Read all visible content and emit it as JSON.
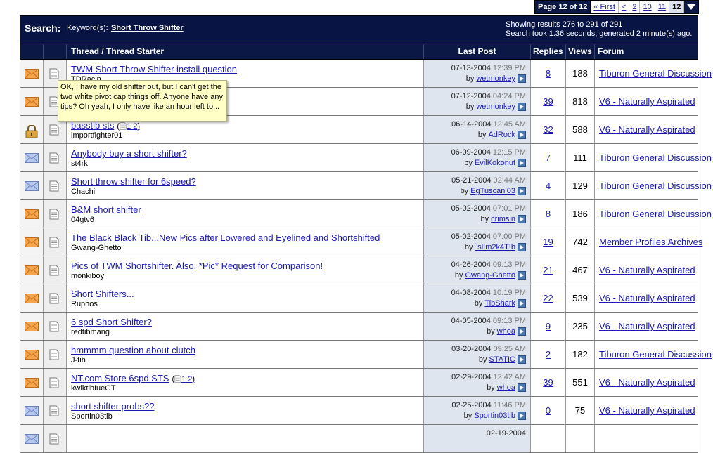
{
  "pagination": {
    "label": "Page 12 of 12",
    "first": "« First",
    "prev": "<",
    "pages": [
      "2",
      "10",
      "11"
    ],
    "current": "12",
    "menu_icon": "triangle-down-icon"
  },
  "search_header": {
    "label": "Search:",
    "keyword_label": "Keyword(s):",
    "keyword": "Short Throw Shifter",
    "results_text": "Showing results 276 to 291 of 291",
    "timing_text": "Search took 1.36 seconds; generated 2 minute(s) ago."
  },
  "columns": {
    "thread": "Thread / Thread Starter",
    "last_post": "Last Post",
    "replies": "Replies",
    "views": "Views",
    "forum": "Forum"
  },
  "tooltip": {
    "text": "OK, I have my old shifter out, but I can't get the two white pivot cap things off.  Anyone have any tips?  Oh yeah, I only have like an hour left to..."
  },
  "rows": [
    {
      "icon": "envelope-orange-icon",
      "title": "TWM Short Throw Shifter install question",
      "starter": "TDRacin",
      "pages": "",
      "date": "07-13-2004",
      "time": "12:39 PM",
      "by_label": "by",
      "by": "wetmonkey",
      "replies": "8",
      "views": "188",
      "forum": "Tiburon General Discussion"
    },
    {
      "icon": "envelope-orange-icon",
      "title": "",
      "starter": "",
      "pages": "",
      "date": "07-12-2004",
      "time": "04:24 PM",
      "by_label": "by",
      "by": "wetmonkey",
      "replies": "39",
      "views": "818",
      "forum": "V6 - Naturally Aspirated"
    },
    {
      "icon": "lock-icon",
      "title": "basstib sts",
      "starter": "importfighter01",
      "pages": "1 2",
      "date": "06-14-2004",
      "time": "12:45 AM",
      "by_label": "by",
      "by": "AdRock",
      "replies": "32",
      "views": "588",
      "forum": "V6 - Naturally Aspirated"
    },
    {
      "icon": "envelope-blue-icon",
      "title": "Anybody buy a short shifter?",
      "starter": "st4rk",
      "pages": "",
      "date": "06-09-2004",
      "time": "12:15 PM",
      "by_label": "by",
      "by": "EvilKokonut",
      "replies": "7",
      "views": "111",
      "forum": "Tiburon General Discussion"
    },
    {
      "icon": "envelope-blue-icon",
      "title": "Short throw shifter for 6speed?",
      "starter": "Chachi",
      "pages": "",
      "date": "05-21-2004",
      "time": "02:44 AM",
      "by_label": "by",
      "by": "EgTuscani03",
      "replies": "4",
      "views": "129",
      "forum": "Tiburon General Discussion"
    },
    {
      "icon": "envelope-orange-icon",
      "title": "B&M short shifter",
      "starter": "04gtv6",
      "pages": "",
      "date": "05-02-2004",
      "time": "07:01 PM",
      "by_label": "by",
      "by": "crimsin",
      "replies": "8",
      "views": "186",
      "forum": "Tiburon General Discussion"
    },
    {
      "icon": "envelope-orange-icon",
      "title": "The Black Black Tib...New Pics after Lowered and Eyelined and Shortshifted",
      "starter": "Gwang-Ghetto",
      "pages": "",
      "date": "05-02-2004",
      "time": "07:00 PM",
      "by_label": "by",
      "by": "`sl!m2k4T!b",
      "replies": "19",
      "views": "742",
      "forum": "Member Profiles Archives"
    },
    {
      "icon": "envelope-orange-icon",
      "title": "Pics of TWM Shortshifter. Also, *Pic* Request for Comparison!",
      "starter": "monkiboy",
      "pages": "",
      "date": "04-26-2004",
      "time": "09:13 PM",
      "by_label": "by",
      "by": "Gwang-Ghetto",
      "replies": "21",
      "views": "467",
      "forum": "V6 - Naturally Aspirated"
    },
    {
      "icon": "envelope-orange-icon",
      "title": "Short Shifters...",
      "starter": "Ruphos",
      "pages": "",
      "date": "04-08-2004",
      "time": "10:19 PM",
      "by_label": "by",
      "by": "TibShark",
      "replies": "22",
      "views": "539",
      "forum": "V6 - Naturally Aspirated"
    },
    {
      "icon": "envelope-orange-icon",
      "title": "6 spd Short Shifter?",
      "starter": "redtibmang",
      "pages": "",
      "date": "04-05-2004",
      "time": "09:13 PM",
      "by_label": "by",
      "by": "whoa",
      "replies": "9",
      "views": "235",
      "forum": "V6 - Naturally Aspirated"
    },
    {
      "icon": "envelope-orange-icon",
      "title": "hmmmm question about clutch",
      "starter": "J-tib",
      "pages": "",
      "date": "03-20-2004",
      "time": "09:25 AM",
      "by_label": "by",
      "by": "STATIC",
      "replies": "2",
      "views": "182",
      "forum": "Tiburon General Discussion"
    },
    {
      "icon": "envelope-orange-icon",
      "title": "NT.com Store 6spd STS",
      "starter": "kwiktibIueGT",
      "pages": "1 2",
      "date": "02-29-2004",
      "time": "12:42 AM",
      "by_label": "by",
      "by": "whoa",
      "replies": "39",
      "views": "551",
      "forum": "V6 - Naturally Aspirated"
    },
    {
      "icon": "envelope-blue-icon",
      "title": "short shifter probs??",
      "starter": "Sportin03tib",
      "pages": "",
      "date": "02-25-2004",
      "time": "11:46 PM",
      "by_label": "by",
      "by": "Sportin03tib",
      "replies": "0",
      "views": "75",
      "forum": "V6 - Naturally Aspirated"
    },
    {
      "icon": "envelope-blue-icon",
      "title": "",
      "starter": "",
      "pages": "",
      "date": "02-19-2004",
      "time": "",
      "by_label": "",
      "by": "",
      "replies": "",
      "views": "",
      "forum": ""
    }
  ]
}
